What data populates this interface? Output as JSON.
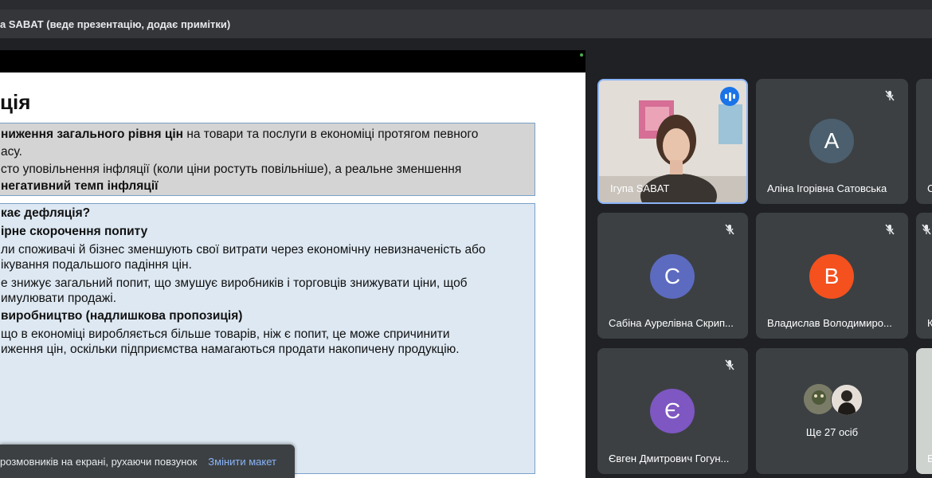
{
  "banner": {
    "text": "а SABAT (веде презентацію, додає примітки)"
  },
  "slide": {
    "title": "ція",
    "box1": {
      "line1_bold": "ниження загального рівня цін",
      "line1_rest": " на товари та послуги в економіці протягом певного",
      "line2": "асу.",
      "line3": "сто уповільнення інфляції (коли ціни ростуть повільніше), а реальне зменшення",
      "line4": "негативний темп інфляції"
    },
    "box2": {
      "l1": "кає дефляція?",
      "l2": "ірне скорочення попиту",
      "l3": "ли споживачі й бізнес зменшують свої витрати через економічну невизначеність або",
      "l4": "ікування подальшого падіння цін.",
      "l5": "е знижує загальний попит, що змушує виробників і торговців знижувати ціни, щоб",
      "l6": "имулювати продажі.",
      "l7": "виробництво (надлишкова пропозиція)",
      "l8": "що в економіці виробляється більше товарів, ніж є попит, це може спричинити",
      "l9": "иження цін, оскільки підприємства намагаються продати накопичену продукцію."
    }
  },
  "toast": {
    "message": "розмовників на екрані, рухаючи повзунок",
    "action": "Змінити макет"
  },
  "participants": {
    "speaker": {
      "name": "Ігупа SABAT"
    },
    "p1": {
      "initial": "A",
      "name": "Аліна Ігорівна Сатовська",
      "color": "#4b5f6e",
      "edge": "С"
    },
    "p2": {
      "initial": "C",
      "name": "Сабіна Аурелівна Скрип...",
      "color": "#5c6bc0"
    },
    "p3": {
      "initial": "B",
      "name": "Владислав Володимиро...",
      "color": "#f4511e",
      "edge": "К"
    },
    "p4": {
      "initial": "Є",
      "name": "Євген Дмитрович Гогун...",
      "color": "#7e57c2",
      "edge": "Б"
    },
    "more": {
      "label": "Ще 27 осіб"
    }
  },
  "icons": {
    "muted": "mic-off-icon",
    "speaking": "audio-level-icon"
  }
}
